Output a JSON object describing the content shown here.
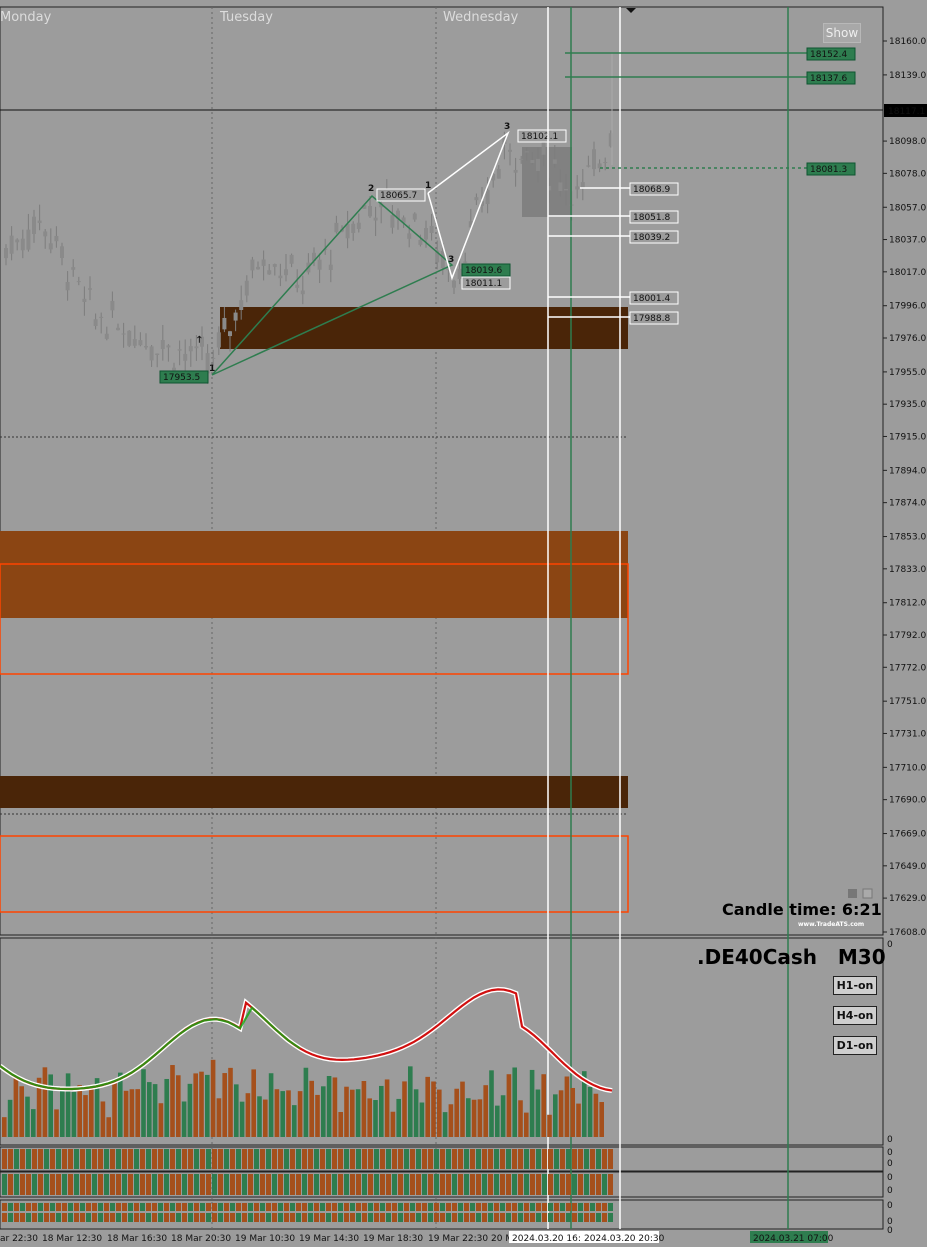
{
  "chart": {
    "day_labels": [
      "Monday",
      "Tuesday",
      "Wednesday"
    ],
    "price_axis": [
      "18160.0",
      "18139.0",
      "18098.0",
      "18078.0",
      "18057.0",
      "18037.0",
      "18017.0",
      "17996.0",
      "17976.0",
      "17955.0",
      "17935.0",
      "17915.0",
      "17894.0",
      "17874.0",
      "17853.0",
      "17833.0",
      "17812.0",
      "17792.0",
      "17772.0",
      "17751.0",
      "17731.0",
      "17710.0",
      "17690.0",
      "17669.0",
      "17649.0",
      "17629.0",
      "17608.0"
    ],
    "current_price": "18117.1",
    "levels": [
      {
        "label": "18152.4",
        "style": "green"
      },
      {
        "label": "18137.6",
        "style": "green"
      },
      {
        "label": "18081.3",
        "style": "green"
      },
      {
        "label": "18068.9",
        "style": "white"
      },
      {
        "label": "18051.8",
        "style": "white"
      },
      {
        "label": "18039.2",
        "style": "white"
      },
      {
        "label": "18001.4",
        "style": "white"
      },
      {
        "label": "17988.8",
        "style": "white"
      }
    ],
    "pattern_labels": {
      "p1_green": "17953.5",
      "p2_green": "18065.7",
      "p3_green": "18019.6",
      "p3_white_top": "18102.1",
      "p3_white_bottom": "18011.1"
    },
    "wave_numbers": [
      "1",
      "2",
      "1",
      "3",
      "3"
    ],
    "show_button": "Show",
    "candle_time_label": "Candle time:",
    "candle_time_value": "6:21",
    "watermark": "www.TradeATS.com"
  },
  "indicator": {
    "symbol": ".DE40Cash",
    "timeframe": "M30",
    "buttons": [
      "H1-on",
      "H4-on",
      "D1-on"
    ],
    "zero_labels": [
      "0",
      "0",
      "0",
      "0",
      "0",
      "0",
      "0",
      "0",
      "0"
    ]
  },
  "time_axis": {
    "labels": [
      "ar 22:30",
      "18 Mar 12:30",
      "18 Mar 16:30",
      "18 Mar 20:30",
      "19 Mar 10:30",
      "19 Mar 14:30",
      "19 Mar 18:30",
      "19 Mar 22:30",
      "20 M"
    ],
    "markers": [
      "2024.03.20 16:1",
      "2024.03.20 20:30",
      "2024.03.21 07:00"
    ]
  },
  "colors": {
    "background": "#9c9c9c",
    "green": "#2e7d4f",
    "dark_brown": "#4a2508",
    "orange_brown": "#8b4513",
    "orange_outline": "#ff4500"
  }
}
